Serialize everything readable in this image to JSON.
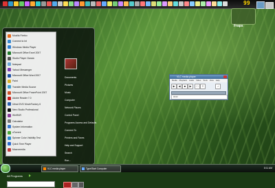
{
  "top_bar": {
    "icon_colors": [
      "#d33",
      "#39c",
      "#fc3",
      "#6c6",
      "#c6f",
      "#fa3",
      "#3cc",
      "#999",
      "#e55",
      "#5ae",
      "#ccc",
      "#fd5",
      "#8d8",
      "#b8f",
      "#f93",
      "#4bb",
      "#bbb",
      "#e66",
      "#6af",
      "#ee6",
      "#7c7",
      "#c8f",
      "#fb5",
      "#5cc",
      "#aaa",
      "#f77",
      "#7bf",
      "#dd7",
      "#9e9",
      "#d9f",
      "#fc7",
      "#6dd",
      "#ccc",
      "#f88",
      "#8cf",
      "#ee8",
      "#aea",
      "#e9f",
      "#fd9",
      "#8ee",
      "#ddd"
    ],
    "fraps_counter": "99",
    "fraps_label": "Fraps"
  },
  "start_menu": {
    "pinned": [
      {
        "label": "Mozilla Firefox",
        "color": "#e76a1c"
      },
      {
        "label": "Connect to Int",
        "color": "#3a8ad0"
      }
    ],
    "recent": [
      {
        "label": "Windows Media Player",
        "color": "#2d7fd3"
      },
      {
        "label": "Microsoft Office Excel 2007",
        "color": "#1f7a2a"
      },
      {
        "label": "Studio Player Classic",
        "color": "#555555"
      },
      {
        "label": "Notepad",
        "color": "#6aa6d8"
      },
      {
        "label": "Yahoo! Messenger",
        "color": "#7b3bb0"
      },
      {
        "label": "Microsoft Office Word 2007",
        "color": "#1b4fa8"
      },
      {
        "label": "Paint",
        "color": "#d8b02a"
      },
      {
        "label": "Transfer Media Source",
        "color": "#3b9bd0"
      },
      {
        "label": "Microsoft Office PowerPoint 2007",
        "color": "#d0532a"
      },
      {
        "label": "Adobe Reader 7.0",
        "color": "#c81e1e"
      },
      {
        "label": "Ulead DVD MovieFactory 6",
        "color": "#2a5fb0"
      },
      {
        "label": "Nero Studio Professional",
        "color": "#111111"
      },
      {
        "label": "WinRAR",
        "color": "#8a3a9a"
      },
      {
        "label": "Calculator",
        "color": "#777777"
      },
      {
        "label": "System Information",
        "color": "#3a7ad0"
      },
      {
        "label": "uTorrent",
        "color": "#4aa83a"
      },
      {
        "label": "Spinner Color Visibility Test",
        "color": "#2a8ad0"
      },
      {
        "label": "Quick Time Player",
        "color": "#2a6ad0"
      },
      {
        "label": "Macromedia",
        "color": "#c33a3a"
      }
    ],
    "all_programs_label": "All Programs",
    "right_items": [
      "Documents",
      "Pictures",
      "Music",
      "Computer",
      "Network Places",
      "Control Panel",
      "Programs Access and Defaults",
      "Connect To",
      "Printers and Faxes",
      "Help and Support",
      "Search",
      "Run..."
    ]
  },
  "vlc": {
    "title": "VLC media player",
    "menu": [
      "Media",
      "Playback",
      "Audio",
      "Video",
      "Tools",
      "View",
      "Help"
    ],
    "status": "00:00"
  },
  "taskbar": {
    "buttons": [
      "VLC media player",
      "Type/Start Computer"
    ],
    "clock": "8:11 AM"
  }
}
